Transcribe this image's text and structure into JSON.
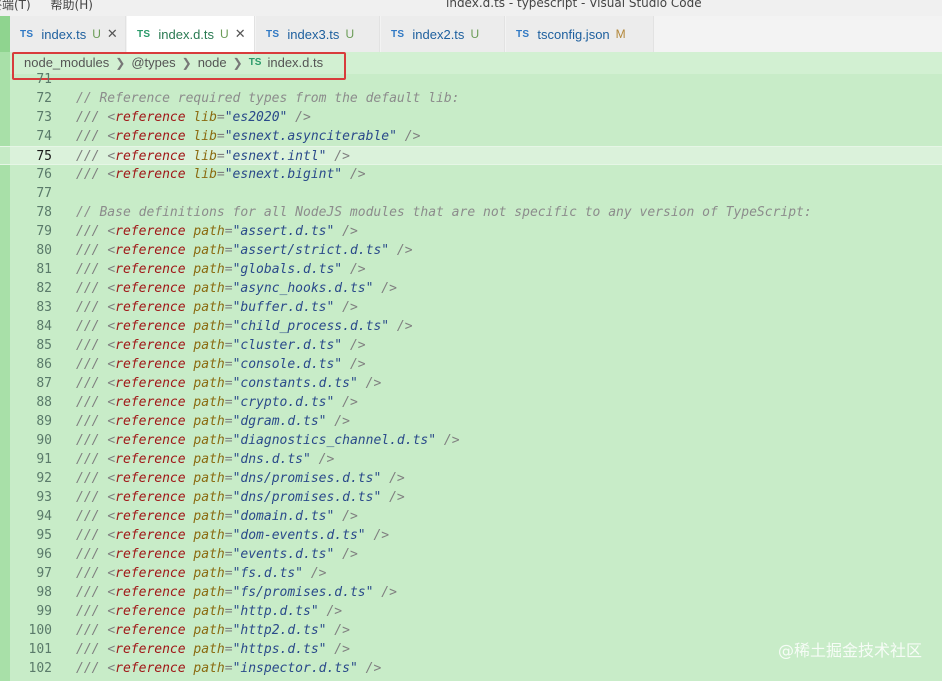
{
  "window": {
    "menu_left": [
      "终端(T)",
      "帮助(H)"
    ],
    "title": "index.d.ts - typescript - Visual Studio Code"
  },
  "tabs": [
    {
      "icon": "TS",
      "label": "index.ts",
      "status": "U",
      "active": false
    },
    {
      "icon": "TS",
      "label": "index.d.ts",
      "status": "U",
      "active": true
    },
    {
      "icon": "TS",
      "label": "index3.ts",
      "status": "U",
      "active": false
    },
    {
      "icon": "TS",
      "label": "index2.ts",
      "status": "U",
      "active": false
    },
    {
      "icon": "TS",
      "label": "tsconfig.json",
      "status": "M",
      "active": false
    }
  ],
  "breadcrumb": [
    "node_modules",
    "@types",
    "node",
    "index.d.ts"
  ],
  "breadcrumb_file_icon": "TS",
  "editor": {
    "current_line": 75,
    "lines": [
      {
        "n": "71",
        "kind": "blank"
      },
      {
        "n": "72",
        "kind": "comment",
        "text": "// Reference required types from the default lib:"
      },
      {
        "n": "73",
        "kind": "ref",
        "attr": "lib",
        "value": "\"es2020\""
      },
      {
        "n": "74",
        "kind": "ref",
        "attr": "lib",
        "value": "\"esnext.asynciterable\""
      },
      {
        "n": "75",
        "kind": "ref",
        "attr": "lib",
        "value": "\"esnext.intl\""
      },
      {
        "n": "76",
        "kind": "ref",
        "attr": "lib",
        "value": "\"esnext.bigint\""
      },
      {
        "n": "77",
        "kind": "blank"
      },
      {
        "n": "78",
        "kind": "comment",
        "text": "// Base definitions for all NodeJS modules that are not specific to any version of TypeScript:"
      },
      {
        "n": "79",
        "kind": "ref",
        "attr": "path",
        "value": "\"assert.d.ts\""
      },
      {
        "n": "80",
        "kind": "ref",
        "attr": "path",
        "value": "\"assert/strict.d.ts\""
      },
      {
        "n": "81",
        "kind": "ref",
        "attr": "path",
        "value": "\"globals.d.ts\""
      },
      {
        "n": "82",
        "kind": "ref",
        "attr": "path",
        "value": "\"async_hooks.d.ts\""
      },
      {
        "n": "83",
        "kind": "ref",
        "attr": "path",
        "value": "\"buffer.d.ts\""
      },
      {
        "n": "84",
        "kind": "ref",
        "attr": "path",
        "value": "\"child_process.d.ts\""
      },
      {
        "n": "85",
        "kind": "ref",
        "attr": "path",
        "value": "\"cluster.d.ts\""
      },
      {
        "n": "86",
        "kind": "ref",
        "attr": "path",
        "value": "\"console.d.ts\""
      },
      {
        "n": "87",
        "kind": "ref",
        "attr": "path",
        "value": "\"constants.d.ts\""
      },
      {
        "n": "88",
        "kind": "ref",
        "attr": "path",
        "value": "\"crypto.d.ts\""
      },
      {
        "n": "89",
        "kind": "ref",
        "attr": "path",
        "value": "\"dgram.d.ts\""
      },
      {
        "n": "90",
        "kind": "ref",
        "attr": "path",
        "value": "\"diagnostics_channel.d.ts\""
      },
      {
        "n": "91",
        "kind": "ref",
        "attr": "path",
        "value": "\"dns.d.ts\""
      },
      {
        "n": "92",
        "kind": "ref",
        "attr": "path",
        "value": "\"dns/promises.d.ts\""
      },
      {
        "n": "93",
        "kind": "ref",
        "attr": "path",
        "value": "\"dns/promises.d.ts\""
      },
      {
        "n": "94",
        "kind": "ref",
        "attr": "path",
        "value": "\"domain.d.ts\""
      },
      {
        "n": "95",
        "kind": "ref",
        "attr": "path",
        "value": "\"dom-events.d.ts\""
      },
      {
        "n": "96",
        "kind": "ref",
        "attr": "path",
        "value": "\"events.d.ts\""
      },
      {
        "n": "97",
        "kind": "ref",
        "attr": "path",
        "value": "\"fs.d.ts\""
      },
      {
        "n": "98",
        "kind": "ref",
        "attr": "path",
        "value": "\"fs/promises.d.ts\""
      },
      {
        "n": "99",
        "kind": "ref",
        "attr": "path",
        "value": "\"http.d.ts\""
      },
      {
        "n": "100",
        "kind": "ref",
        "attr": "path",
        "value": "\"http2.d.ts\""
      },
      {
        "n": "101",
        "kind": "ref",
        "attr": "path",
        "value": "\"https.d.ts\""
      },
      {
        "n": "102",
        "kind": "ref",
        "attr": "path",
        "value": "\"inspector.d.ts\""
      }
    ],
    "syntax": {
      "prefix": "/// ",
      "lt": "<",
      "tag": "reference",
      "eq": "=",
      "close": " />"
    }
  },
  "watermark": "@稀土掘金技术社区",
  "colors": {
    "editor_bg": "#c8ecc8",
    "highlight_box": "#d83c3c",
    "tag": "#a01818",
    "attr": "#8a6a10",
    "string": "#2a4a8a"
  }
}
